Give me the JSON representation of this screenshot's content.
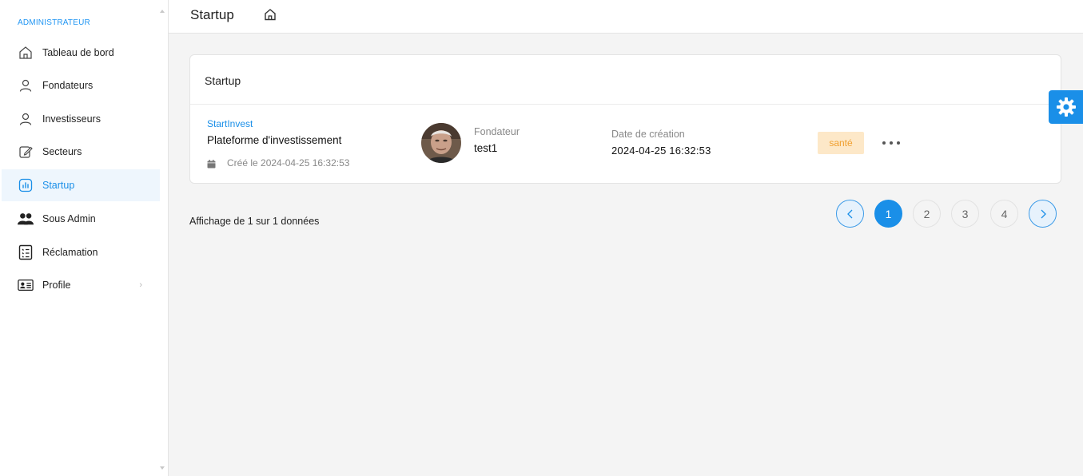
{
  "sidebar": {
    "section": "ADMINISTRATEUR",
    "items": [
      {
        "label": "Tableau de bord",
        "icon": "home-icon"
      },
      {
        "label": "Fondateurs",
        "icon": "user-icon"
      },
      {
        "label": "Investisseurs",
        "icon": "user-icon"
      },
      {
        "label": "Secteurs",
        "icon": "edit-icon"
      },
      {
        "label": "Startup",
        "icon": "chart-icon",
        "active": true
      },
      {
        "label": "Sous Admin",
        "icon": "users-icon"
      },
      {
        "label": "Réclamation",
        "icon": "checklist-icon"
      },
      {
        "label": "Profile",
        "icon": "id-card-icon"
      }
    ]
  },
  "header": {
    "title": "Startup"
  },
  "card": {
    "title": "Startup",
    "row": {
      "link": "StartInvest",
      "name": "Plateforme d'investissement",
      "created": "Créé le 2024-04-25 16:32:53",
      "founder_label": "Fondateur",
      "founder": "test1",
      "date_label": "Date de création",
      "date": "2024-04-25 16:32:53",
      "badge": "santé"
    }
  },
  "pagination": {
    "info": "Affichage de 1 sur 1 données",
    "pages": [
      "1",
      "2",
      "3",
      "4"
    ],
    "current": "1"
  },
  "colors": {
    "accent": "#1a8fe8",
    "badge_bg": "#fde8c8",
    "badge_text": "#f0a030"
  }
}
